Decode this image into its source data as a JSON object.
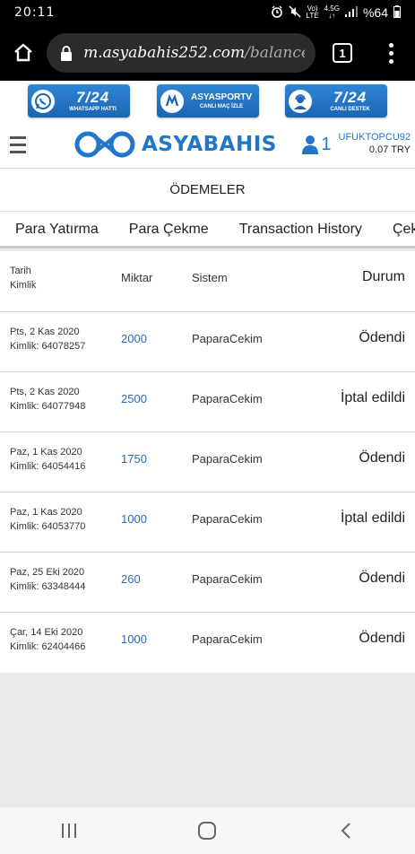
{
  "status_bar": {
    "time": "20:11",
    "network_top": "Vo)",
    "network_bottom": "LTE",
    "net_type_top": "4.5G",
    "net_type_bottom": "↓↑",
    "battery": "%64"
  },
  "browser": {
    "url_domain": "m.asyabahis252.com",
    "url_path": "/balance,",
    "tab_count": "1"
  },
  "promos": [
    {
      "big": "7/24",
      "small": "WHATSAPP HATTI",
      "icon": "whatsapp-icon"
    },
    {
      "big": "ASYASPORTV",
      "small": "CANLI MAÇ İZLE",
      "icon": "tv-logo-icon"
    },
    {
      "big": "7/24",
      "small": "CANLI DESTEK",
      "icon": "support-agent-icon"
    }
  ],
  "header": {
    "logo_text": "ASYABAHIS",
    "user_count": "1",
    "username": "UFUKTOPCU92",
    "balance": "0.07 TRY"
  },
  "page_title": "ÖDEMELER",
  "tabs": [
    {
      "label": "Para Yatırma"
    },
    {
      "label": "Para Çekme"
    },
    {
      "label": "Transaction History"
    },
    {
      "label": "Çekim"
    }
  ],
  "table": {
    "headers": {
      "date": "Tarih",
      "id": "Kimlik",
      "amount": "Miktar",
      "system": "Sistem",
      "status": "Durum"
    },
    "rows": [
      {
        "date": "Pts, 2 Kas 2020",
        "id": "Kimlik: 64078257",
        "amount": "2000",
        "system": "PaparaCekim",
        "status": "Ödendi"
      },
      {
        "date": "Pts, 2 Kas 2020",
        "id": "Kimlik: 64077948",
        "amount": "2500",
        "system": "PaparaCekim",
        "status": "İptal edildi"
      },
      {
        "date": "Paz, 1 Kas 2020",
        "id": "Kimlik: 64054416",
        "amount": "1750",
        "system": "PaparaCekim",
        "status": "Ödendi"
      },
      {
        "date": "Paz, 1 Kas 2020",
        "id": "Kimlik: 64053770",
        "amount": "1000",
        "system": "PaparaCekim",
        "status": "İptal edildi"
      },
      {
        "date": "Paz, 25 Eki 2020",
        "id": "Kimlik: 63348444",
        "amount": "260",
        "system": "PaparaCekim",
        "status": "Ödendi"
      },
      {
        "date": "Çar, 14 Eki 2020",
        "id": "Kimlik: 62404466",
        "amount": "1000",
        "system": "PaparaCekim",
        "status": "Ödendi"
      }
    ]
  },
  "colors": {
    "brand_blue": "#2276c9",
    "amount_blue": "#2b6bb3",
    "promo_blue": "#1a66b3"
  }
}
